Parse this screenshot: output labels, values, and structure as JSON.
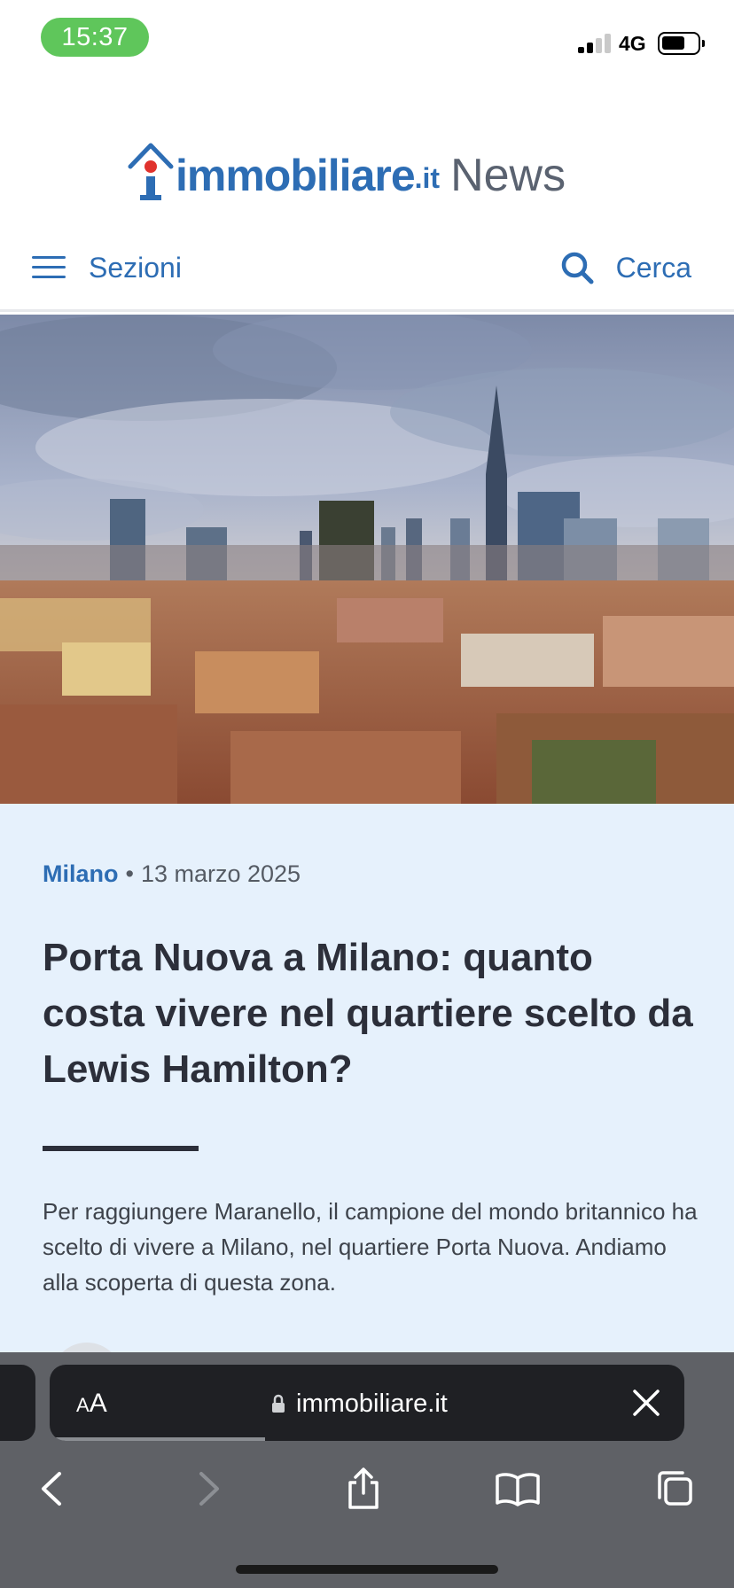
{
  "status_bar": {
    "time": "15:37",
    "network": "4G",
    "battery_level": 0.65,
    "signal_bars": 2
  },
  "header": {
    "logo_word": "immobiliare",
    "logo_tld": ".it",
    "logo_suffix": "News"
  },
  "nav": {
    "menu_label": "Sezioni",
    "search_label": "Cerca"
  },
  "article": {
    "category": "Milano",
    "separator": "•",
    "date": "13 marzo 2025",
    "headline": "Porta Nuova a Milano: quanto costa vivere nel quartiere scelto da Lewis Hamilton?",
    "summary": "Per raggiungere Maranello, il campione del mondo britannico ha scelto di vivere a Milano, nel quartiere Porta Nuova. Andiamo alla scoperta di questa zona."
  },
  "browser": {
    "text_size_small": "A",
    "text_size_large": "A",
    "url": "immobiliare.it",
    "load_progress": 0.34
  },
  "colors": {
    "brand_blue": "#2d6db4",
    "article_bg": "#e6f1fc",
    "status_pill": "#5fc65b",
    "browser_bg": "#5f6166"
  },
  "icons": [
    "hamburger-icon",
    "search-icon",
    "lock-icon",
    "close-icon",
    "back-icon",
    "forward-icon",
    "share-icon",
    "bookmarks-icon",
    "tabs-icon"
  ]
}
